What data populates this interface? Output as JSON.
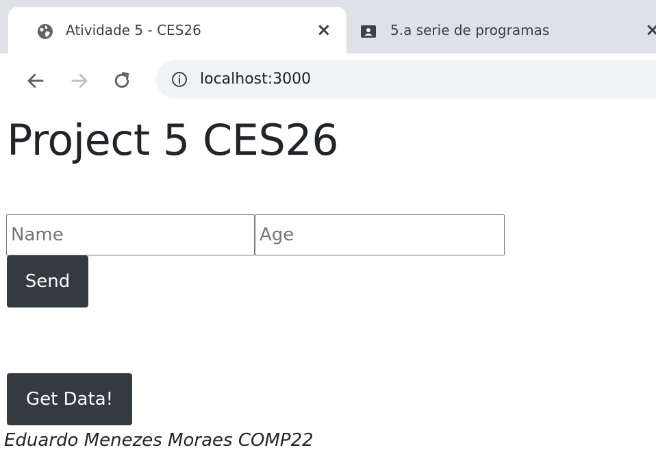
{
  "browser": {
    "tabs": [
      {
        "title": "Atividade 5 - CES26",
        "icon": "globe-icon",
        "active": true,
        "close": "×"
      },
      {
        "title": "5.a serie de programas",
        "icon": "classroom-icon",
        "active": false,
        "close": "×"
      }
    ],
    "address": "localhost:3000",
    "nav_icons": [
      "back-arrow-icon",
      "forward-arrow-icon",
      "reload-icon",
      "info-icon"
    ]
  },
  "page": {
    "title": "Project 5 CES26",
    "form": {
      "name_placeholder": "Name",
      "name_value": "",
      "age_placeholder": "Age",
      "age_value": "",
      "send_label": "Send"
    },
    "get_data_label": "Get Data!",
    "author": "Eduardo Menezes Moraes COMP22"
  },
  "colors": {
    "button_bg": "#343a40",
    "button_text": "#ffffff",
    "text": "#212529",
    "tabstrip": "#dee1e6",
    "omnibox": "#f1f3f4"
  }
}
